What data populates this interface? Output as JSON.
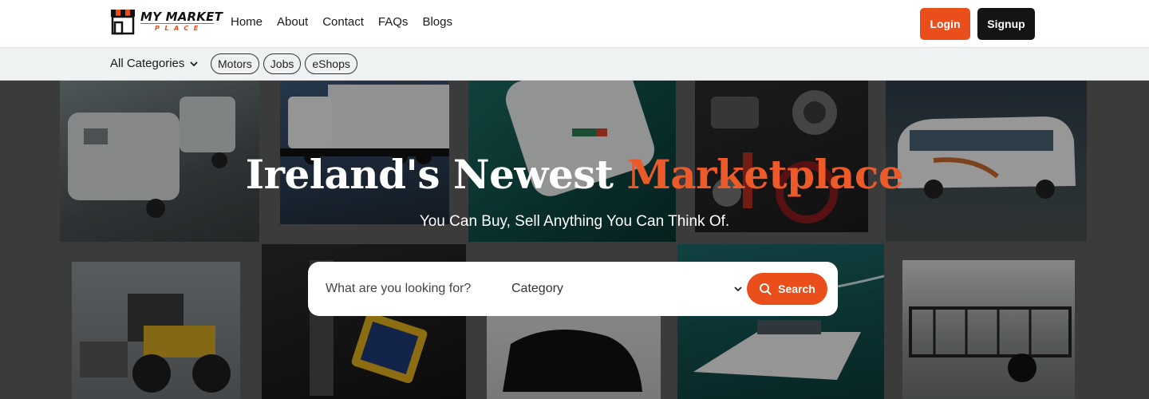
{
  "brand": {
    "name": "MY MARKET",
    "tagline": "PLACE"
  },
  "nav": [
    {
      "label": "Home"
    },
    {
      "label": "About"
    },
    {
      "label": "Contact"
    },
    {
      "label": "FAQs"
    },
    {
      "label": "Blogs"
    }
  ],
  "auth": {
    "login_label": "Login",
    "signup_label": "Signup"
  },
  "categories_bar": {
    "all_label": "All Categories",
    "chips": [
      "Motors",
      "Jobs",
      "eShops"
    ]
  },
  "hero": {
    "title_main": "Ireland's Newest ",
    "title_accent": "Marketplace",
    "subtitle": "You Can Buy, Sell Anything You Can Think Of.",
    "background_tiles": [
      "caravan",
      "truck",
      "appliance",
      "car-parts",
      "coach-bus",
      "wheel-loader",
      "sporting-goods",
      "motor-scooter",
      "speedboat",
      "utility-trailer"
    ]
  },
  "search": {
    "placeholder": "What are you looking for?",
    "category_value": "Category",
    "button_label": "Search"
  },
  "colors": {
    "accent": "#e94e1b",
    "dark": "#141414",
    "catbar_bg": "#eef2f3"
  },
  "icons": {
    "logo": "market-stall-icon",
    "dropdown": "chevron-down-icon",
    "search": "search-icon"
  }
}
